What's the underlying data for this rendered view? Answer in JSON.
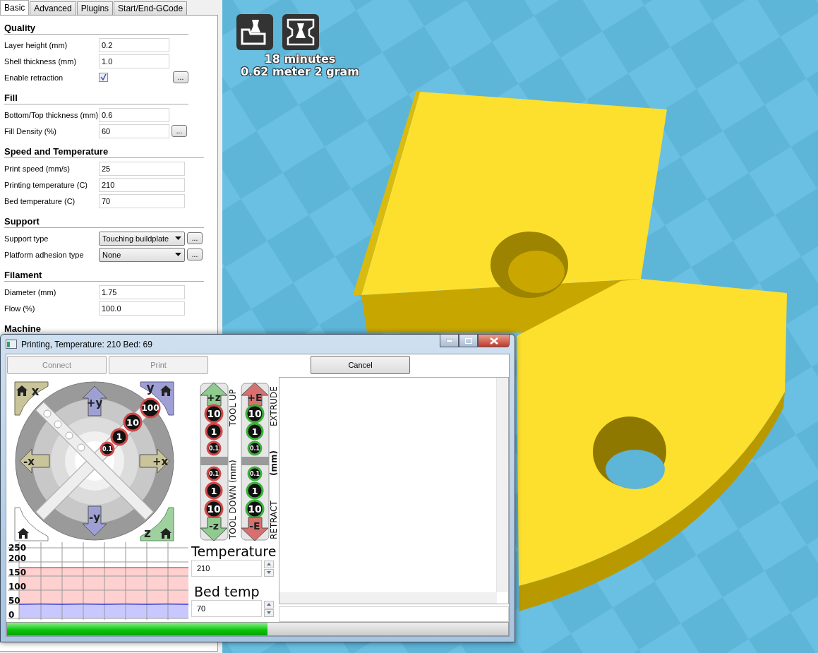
{
  "tabs": [
    {
      "label": "Basic",
      "selected": true
    },
    {
      "label": "Advanced",
      "selected": false
    },
    {
      "label": "Plugins",
      "selected": false
    },
    {
      "label": "Start/End-GCode",
      "selected": false
    }
  ],
  "sections": [
    {
      "title": "Quality",
      "rows": [
        {
          "kind": "text",
          "label": "Layer height (mm)",
          "value": "0.2"
        },
        {
          "kind": "text",
          "label": "Shell thickness (mm)",
          "value": "1.0"
        },
        {
          "kind": "checkbox",
          "label": "Enable retraction",
          "checked": true,
          "more": "..."
        }
      ]
    },
    {
      "title": "Fill",
      "rows": [
        {
          "kind": "text",
          "label": "Bottom/Top thickness (mm)",
          "value": "0.6"
        },
        {
          "kind": "text",
          "label": "Fill Density (%)",
          "value": "60",
          "more": "..."
        }
      ]
    },
    {
      "title": "Speed and Temperature",
      "rows": [
        {
          "kind": "text",
          "label": "Print speed (mm/s)",
          "value": "25"
        },
        {
          "kind": "text",
          "label": "Printing temperature (C)",
          "value": "210"
        },
        {
          "kind": "text",
          "label": "Bed temperature (C)",
          "value": "70"
        }
      ]
    },
    {
      "title": "Support",
      "rows": [
        {
          "kind": "select",
          "label": "Support type",
          "value": "Touching buildplate",
          "more": "..."
        },
        {
          "kind": "select",
          "label": "Platform adhesion type",
          "value": "None",
          "more": "..."
        }
      ]
    },
    {
      "title": "Filament",
      "rows": [
        {
          "kind": "text",
          "label": "Diameter (mm)",
          "value": "1.75"
        },
        {
          "kind": "text",
          "label": "Flow (%)",
          "value": "100.0"
        }
      ]
    },
    {
      "title": "Machine"
    }
  ],
  "viewport": {
    "print_time": "18 minutes",
    "material": "0.62 meter 2 gram"
  },
  "dialog": {
    "title": "Printing, Temperature: 210 Bed: 69",
    "buttons": [
      {
        "label": "Connect",
        "disabled": true
      },
      {
        "label": "Print",
        "disabled": true
      },
      {
        "label": "Cancel",
        "disabled": false
      }
    ],
    "xy_jog": {
      "corners": [
        "x",
        "y",
        "z"
      ],
      "arrows": [
        "+y",
        "-x",
        "+x",
        "-y"
      ],
      "steps": [
        "100",
        "10",
        "1",
        "0.1"
      ]
    },
    "z_jog": {
      "up": "+z",
      "down": "-z",
      "steps": [
        "10",
        "1",
        "0.1",
        "0.1",
        "1",
        "10"
      ],
      "label_top": "TOOL UP",
      "label_bottom": "TOOL DOWN (mm)"
    },
    "e_jog": {
      "up": "+E",
      "down": "-E",
      "steps": [
        "10",
        "1",
        "0.1",
        "0.1",
        "1",
        "10"
      ],
      "label_top": "EXTRUDE",
      "label_middle": "(mm)",
      "label_bottom": "RETRACT"
    },
    "chart_data": {
      "type": "area",
      "grid": true,
      "ylim": [
        0,
        250
      ],
      "yticks": [
        0,
        50,
        100,
        150,
        200,
        250
      ],
      "series": [
        {
          "color": "#ff0000",
          "values": [
            180,
            180,
            180,
            180,
            180,
            180,
            180,
            180,
            180
          ]
        },
        {
          "color": "#0000ff",
          "values": [
            50,
            51,
            50,
            51,
            50,
            51,
            50,
            51,
            50
          ]
        }
      ]
    },
    "temperature": {
      "label": "Temperature",
      "value": "210"
    },
    "bed_temp": {
      "label": "Bed temp",
      "value": "70"
    },
    "progress": {
      "level": 0.52
    }
  }
}
